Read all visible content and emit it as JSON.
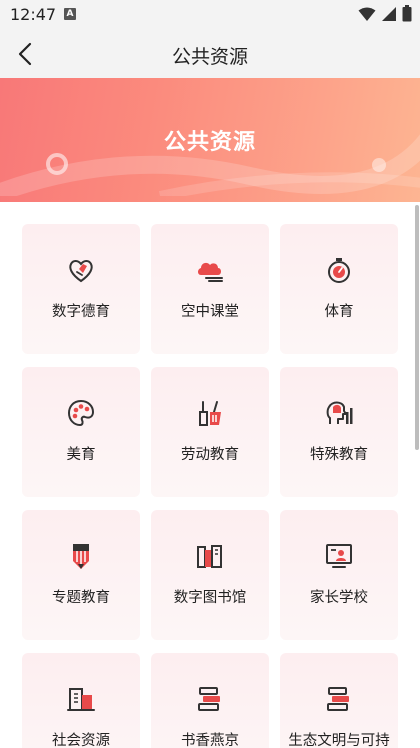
{
  "status": {
    "time": "12:47",
    "notification_badge": "A"
  },
  "nav": {
    "title": "公共资源"
  },
  "banner": {
    "title": "公共资源"
  },
  "cards": [
    {
      "label": "数字德育",
      "icon": "heart-hand-icon"
    },
    {
      "label": "空中课堂",
      "icon": "cloud-icon"
    },
    {
      "label": "体育",
      "icon": "stopwatch-icon"
    },
    {
      "label": "美育",
      "icon": "palette-icon"
    },
    {
      "label": "劳动教育",
      "icon": "broom-icon"
    },
    {
      "label": "特殊教育",
      "icon": "head-chart-icon"
    },
    {
      "label": "专题教育",
      "icon": "pencil-icon"
    },
    {
      "label": "数字图书馆",
      "icon": "books-icon"
    },
    {
      "label": "家长学校",
      "icon": "monitor-user-icon"
    },
    {
      "label": "社会资源",
      "icon": "building-icon"
    },
    {
      "label": "书香燕京",
      "icon": "book-stack-icon"
    },
    {
      "label": "生态文明与可持",
      "icon": "book-stack-icon"
    }
  ],
  "colors": {
    "icon_red": "#e84a4a",
    "icon_dark": "#333333",
    "card_bg": "#fdeef0"
  }
}
